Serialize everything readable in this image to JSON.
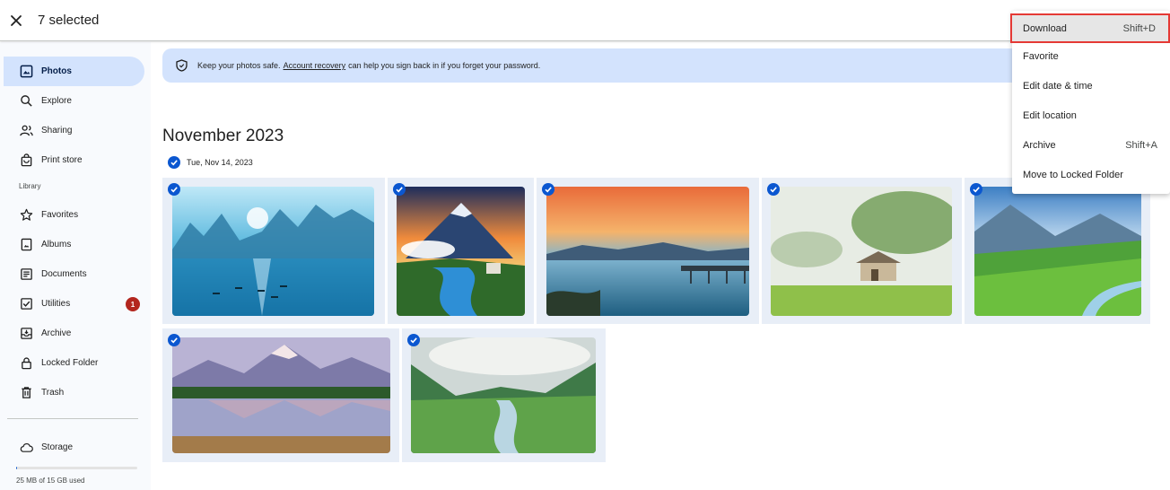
{
  "topbar": {
    "selected_label": "7 selected"
  },
  "sidebar": {
    "items": [
      {
        "label": "Photos",
        "icon": "photo-icon",
        "active": true
      },
      {
        "label": "Explore",
        "icon": "search-icon"
      },
      {
        "label": "Sharing",
        "icon": "people-icon"
      },
      {
        "label": "Print store",
        "icon": "shopping-bag-icon"
      },
      {
        "label": "Favorites",
        "icon": "star-icon"
      },
      {
        "label": "Albums",
        "icon": "album-icon"
      },
      {
        "label": "Documents",
        "icon": "document-icon"
      },
      {
        "label": "Utilities",
        "icon": "checklist-icon",
        "badge": "1"
      },
      {
        "label": "Archive",
        "icon": "archive-icon"
      },
      {
        "label": "Locked Folder",
        "icon": "lock-icon"
      },
      {
        "label": "Trash",
        "icon": "trash-icon"
      },
      {
        "label": "Storage",
        "icon": "cloud-icon"
      }
    ],
    "library_label": "Library",
    "storage_text": "25 MB of 15 GB used",
    "storage_used_fraction": 0.01
  },
  "banner": {
    "text_before": "Keep your photos safe.",
    "link": "Account recovery",
    "text_after": "can help you sign back in if you forget your password."
  },
  "content": {
    "month": "November 2023",
    "day": "Tue, Nov 14, 2023"
  },
  "menu": {
    "items": [
      {
        "label": "Download",
        "shortcut": "Shift+D",
        "highlighted": true
      },
      {
        "label": "Favorite",
        "shortcut": ""
      },
      {
        "label": "Edit date & time",
        "shortcut": ""
      },
      {
        "label": "Edit location",
        "shortcut": ""
      },
      {
        "label": "Archive",
        "shortcut": "Shift+A"
      },
      {
        "label": "Move to Locked Folder",
        "shortcut": ""
      }
    ]
  },
  "colors": {
    "accent": "#0b57d0",
    "active_nav": "#d3e3fd",
    "badge": "#b3261e",
    "highlight_border": "#e53935"
  }
}
